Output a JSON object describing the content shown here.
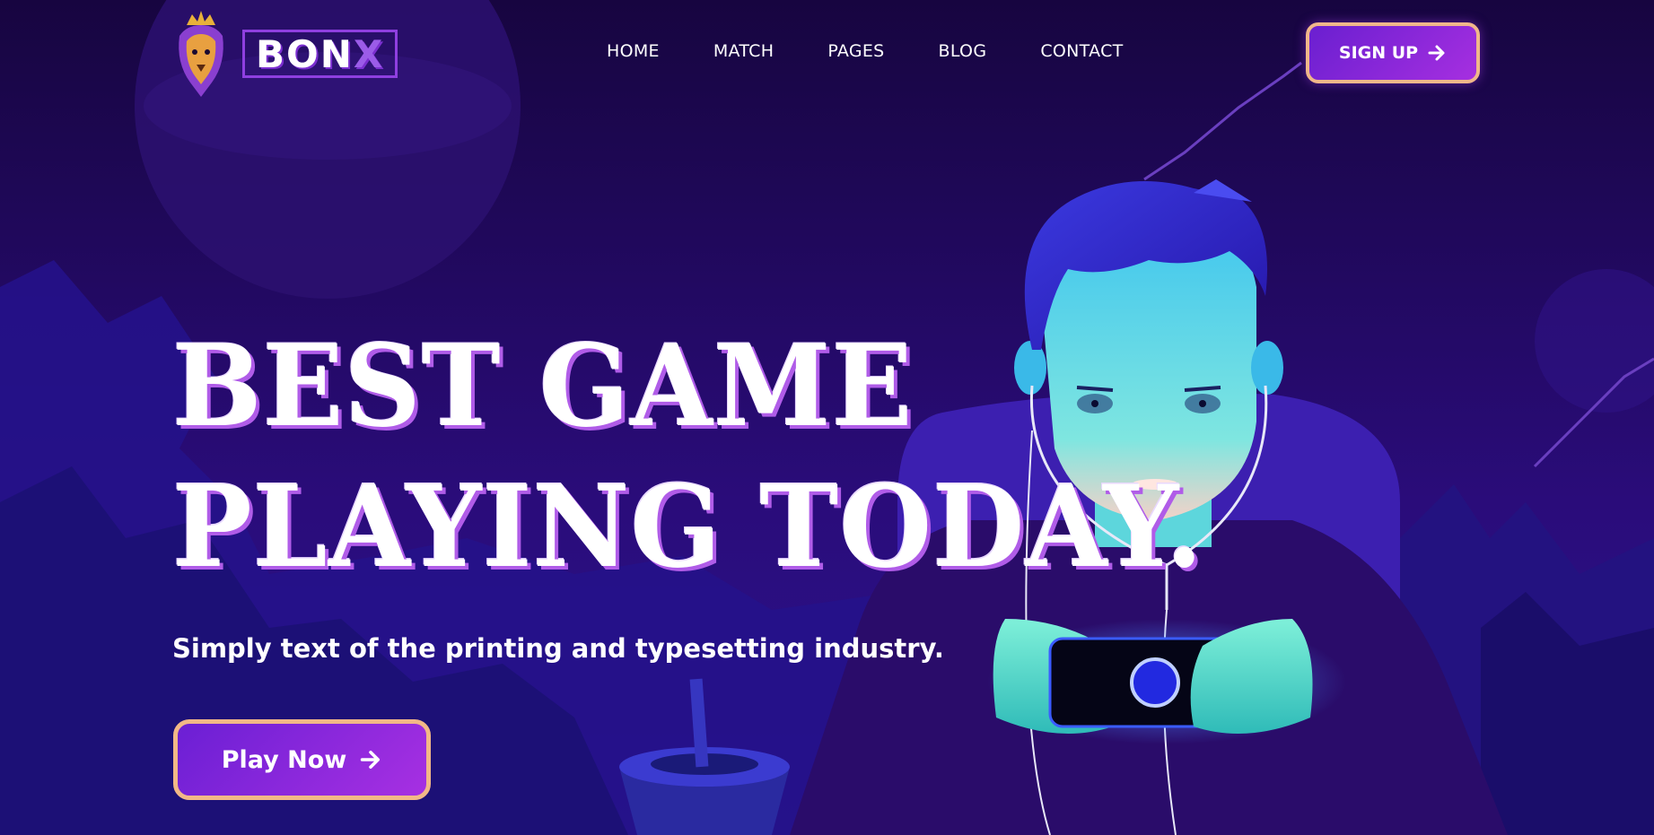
{
  "header": {
    "brand": "BON",
    "brand_x": "X",
    "nav": [
      "HOME",
      "MATCH",
      "PAGES",
      "BLOG",
      "CONTACT"
    ],
    "signup_label": "SIGN UP"
  },
  "hero": {
    "title_line1": "BEST GAME",
    "title_line2": "PLAYING TODAY.",
    "subtitle": "Simply text of the printing and typesetting industry.",
    "cta_label": "Play Now"
  },
  "icons": {
    "logo": "lion-mascot-icon",
    "arrow": "arrow-right-icon"
  },
  "colors": {
    "background": "#1a0845",
    "button_gradient_start": "#6a1fd0",
    "button_gradient_end": "#a62fe0",
    "button_border": "#f0b78a",
    "title_shadow": "#b05ce8"
  }
}
